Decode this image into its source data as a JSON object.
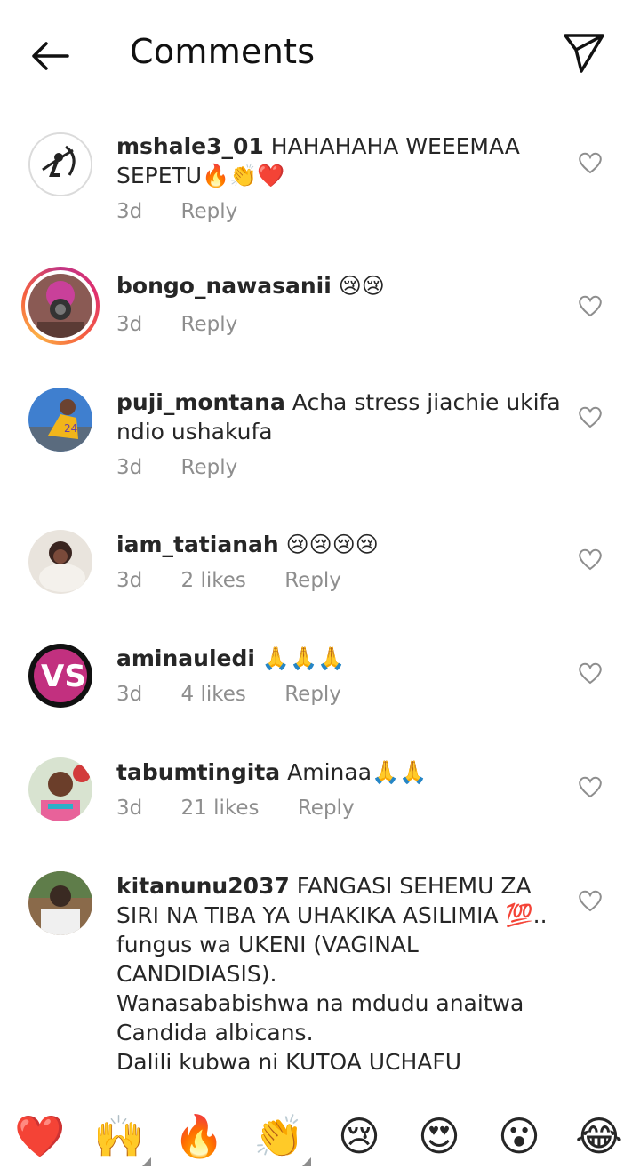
{
  "header": {
    "title": "Comments",
    "back_icon": "arrow-left-icon",
    "send_icon": "paper-plane-icon"
  },
  "comments": [
    {
      "username": "mshale3_01",
      "text": "HAHAHAHA WEEEMAA SEPETU🔥👏❤️",
      "time": "3d",
      "likes": "",
      "reply": "Reply",
      "has_story_ring": false
    },
    {
      "username": "bongo_nawasanii",
      "text": "😢😢",
      "time": "3d",
      "likes": "",
      "reply": "Reply",
      "has_story_ring": true
    },
    {
      "username": "puji_montana",
      "text": "Acha stress jiachie ukifa ndio ushakufa",
      "time": "3d",
      "likes": "",
      "reply": "Reply",
      "has_story_ring": false
    },
    {
      "username": "iam_tatianah",
      "text": "😢😢😢😢",
      "time": "3d",
      "likes": "2 likes",
      "reply": "Reply",
      "has_story_ring": false
    },
    {
      "username": "aminauledi",
      "text": "🙏🙏🙏",
      "time": "3d",
      "likes": "4 likes",
      "reply": "Reply",
      "has_story_ring": false
    },
    {
      "username": "tabumtingita",
      "text": "Aminaa🙏🙏",
      "time": "3d",
      "likes": "21 likes",
      "reply": "Reply",
      "has_story_ring": false
    },
    {
      "username": "kitanunu2037",
      "text": "FANGASI SEHEMU ZA SIRI NA TIBA YA UHAKIKA ASILIMIA 💯..",
      "text_lines": [
        "fungus wa UKENI (VAGINAL CANDIDIASIS).",
        "Wanasababishwa na mdudu anaitwa Candida albicans.",
        "Dalili kubwa ni KUTOA UCHAFU"
      ],
      "time": "",
      "likes": "",
      "reply": "",
      "has_story_ring": false
    }
  ],
  "emoji_bar": [
    "❤️",
    "🙌",
    "🔥",
    "👏",
    "😢",
    "😍",
    "😮",
    "😂"
  ],
  "colors": {
    "secondary_text": "#8e8e8e",
    "primary_text": "#262626",
    "divider": "#dbdbdb"
  }
}
